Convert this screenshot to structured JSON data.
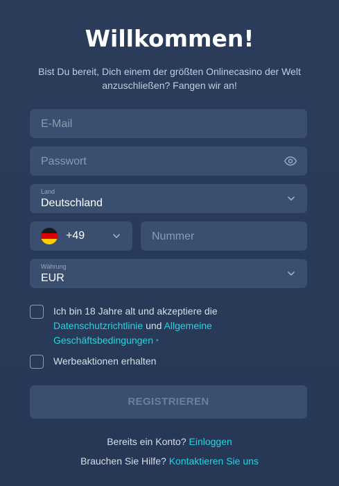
{
  "header": {
    "title": "Willkommen!",
    "subtitle_line1": "Bist Du bereit, Dich einem der größten Onlinecasino der Welt",
    "subtitle_line2": "anzuschließen? Fangen wir an!"
  },
  "form": {
    "email_placeholder": "E-Mail",
    "password_placeholder": "Passwort",
    "country_label": "Land",
    "country_value": "Deutschland",
    "phone_code": "+49",
    "phone_placeholder": "Nummer",
    "currency_label": "Währung",
    "currency_value": "EUR"
  },
  "terms": {
    "line1": "Ich bin 18 Jahre alt und akzeptiere die",
    "privacy_link": "Datenschutzrichtlinie",
    "and": "und",
    "general_link": "Allgemeine",
    "terms_link": "Geschäftsbedingungen",
    "required_mark": "*",
    "promo_label": "Werbeaktionen erhalten"
  },
  "submit_label": "REGISTRIEREN",
  "footer": {
    "account_text": "Bereits ein Konto?",
    "login_link": "Einloggen",
    "help_text": "Brauchen Sie Hilfe?",
    "contact_link": "Kontaktieren Sie uns"
  },
  "icons": {
    "password_toggle": "eye-icon",
    "dropdown": "chevron-down-icon",
    "flag": "germany-flag-icon"
  },
  "colors": {
    "background": "#2b3d5b",
    "field": "#3a4f70",
    "accent": "#2ad2e0"
  }
}
